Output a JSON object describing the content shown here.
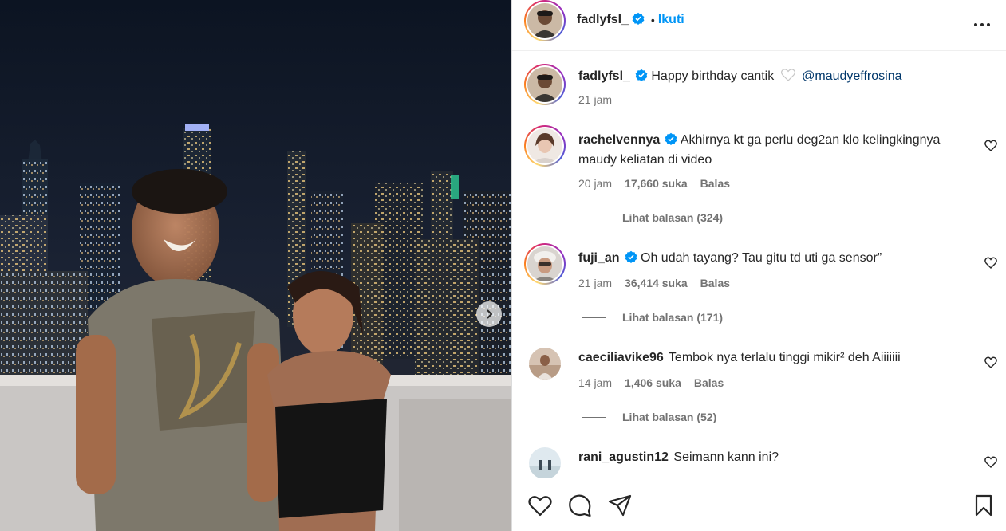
{
  "post": {
    "author": "fadlyfsl_",
    "follow_label": "Ikuti",
    "dot": "•",
    "caption": {
      "username": "fadlyfsl_",
      "text": "Happy birthday cantik",
      "mention": "@maudyeffrosina",
      "time": "21 jam"
    }
  },
  "comments": [
    {
      "username": "rachelvennya",
      "verified": true,
      "text": "Akhirnya kt ga perlu deg2an klo kelingkingnya maudy keliatan di video",
      "time": "20 jam",
      "likes": "17,660 suka",
      "reply_label": "Balas",
      "view_replies": "Lihat balasan (324)"
    },
    {
      "username": "fuji_an",
      "verified": true,
      "text": "Oh udah tayang? Tau gitu td uti ga sensor”",
      "time": "21 jam",
      "likes": "36,414 suka",
      "reply_label": "Balas",
      "view_replies": "Lihat balasan (171)"
    },
    {
      "username": "caeciliavike96",
      "verified": false,
      "text": "Tembok nya terlalu tinggi mikir² deh Aiiiiiii",
      "time": "14 jam",
      "likes": "1,406 suka",
      "reply_label": "Balas",
      "view_replies": "Lihat balasan (52)"
    },
    {
      "username": "rani_agustin12",
      "verified": false,
      "text": "Seimann kann ini?",
      "time": "",
      "likes": "",
      "reply_label": "",
      "view_replies": ""
    }
  ],
  "icons": {
    "like": "heart-icon",
    "comment": "comment-icon",
    "share": "share-icon",
    "save": "bookmark-icon",
    "more": "more-icon",
    "verified": "verified-badge-icon",
    "next": "chevron-right-icon"
  },
  "colors": {
    "accent": "#0095f6",
    "verified": "#0095f6",
    "mention": "#00376b",
    "muted": "#737373"
  }
}
